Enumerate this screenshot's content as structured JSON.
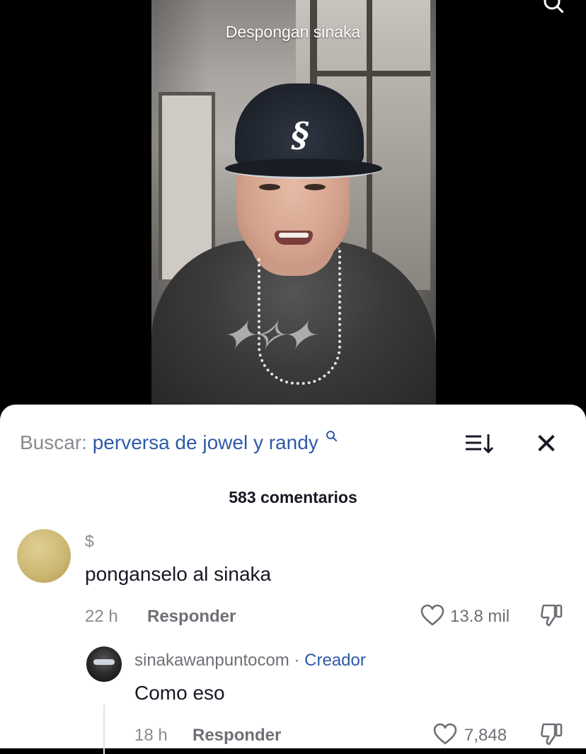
{
  "video": {
    "title": "Despongan sinaka"
  },
  "comments_sheet": {
    "search_label": "Buscar:",
    "search_query": "perversa de jowel y randy",
    "count_text": "583 comentarios",
    "comments": [
      {
        "username": "$",
        "text": "ponganselo al sinaka",
        "time": "22 h",
        "reply_label": "Responder",
        "likes": "13.8 mil"
      }
    ],
    "reply": {
      "username": "sinakawanpuntocom",
      "separator": " · ",
      "badge": "Creador",
      "text": "Como eso",
      "time": "18 h",
      "reply_label": "Responder",
      "likes": "7,848"
    }
  },
  "colors": {
    "link_blue": "#2f5aa8",
    "muted_gray": "#8a8b91",
    "text_dark": "#161823"
  },
  "icons": [
    "search-icon",
    "sort-icon",
    "close-icon",
    "heart-icon",
    "dislike-icon"
  ]
}
